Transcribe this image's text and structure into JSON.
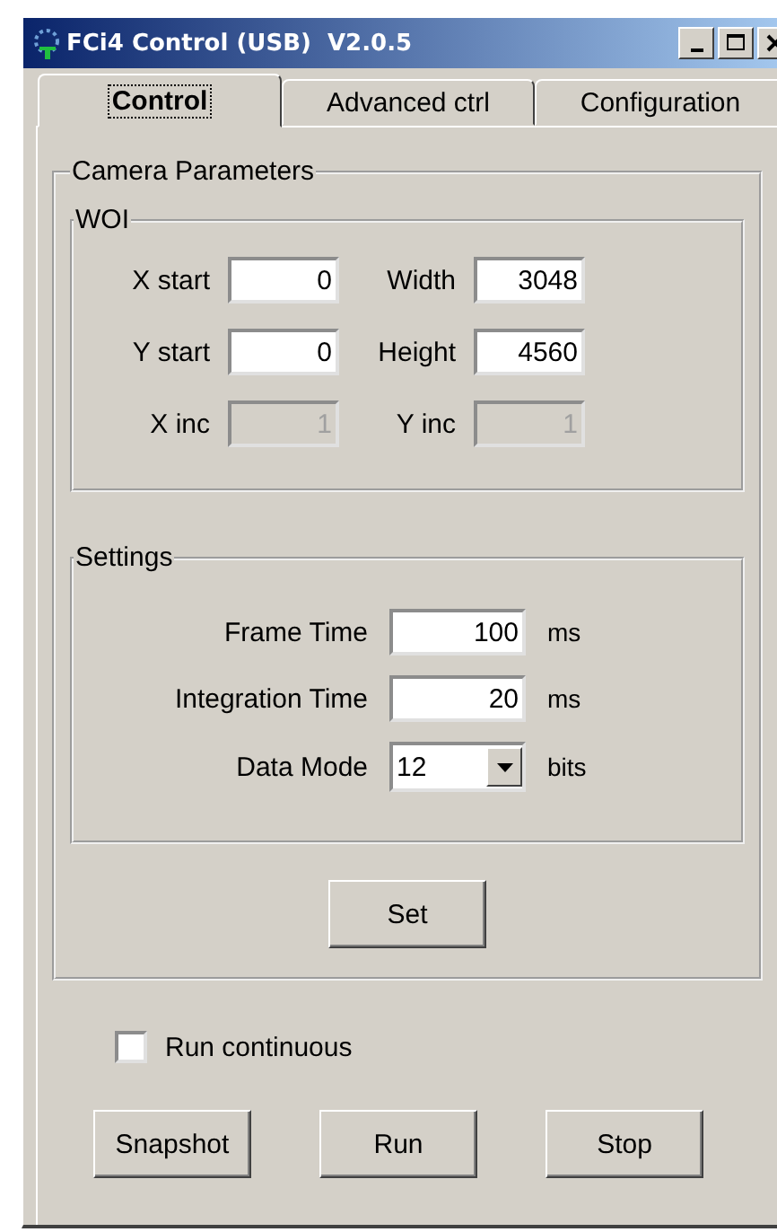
{
  "window": {
    "title": "FCi4 Control (USB)  V2.0.5"
  },
  "tabs": [
    {
      "label": "Control",
      "selected": true
    },
    {
      "label": "Advanced ctrl",
      "selected": false
    },
    {
      "label": "Configuration",
      "selected": false
    }
  ],
  "camera_parameters": {
    "title": "Camera Parameters",
    "woi": {
      "title": "WOI",
      "fields": [
        {
          "label": "X start",
          "value": "0",
          "disabled": false
        },
        {
          "label": "Width",
          "value": "3048",
          "disabled": false
        },
        {
          "label": "Y start",
          "value": "0",
          "disabled": false
        },
        {
          "label": "Height",
          "value": "4560",
          "disabled": false
        },
        {
          "label": "X inc",
          "value": "1",
          "disabled": true
        },
        {
          "label": "Y inc",
          "value": "1",
          "disabled": true
        }
      ]
    },
    "settings": {
      "title": "Settings",
      "rows": [
        {
          "kind": "text",
          "label": "Frame Time",
          "value": "100",
          "unit": "ms"
        },
        {
          "kind": "text",
          "label": "Integration Time",
          "value": "20",
          "unit": "ms"
        },
        {
          "kind": "dropdown",
          "label": "Data Mode",
          "value": "12",
          "unit": "bits"
        }
      ]
    },
    "set_button": "Set"
  },
  "run_continuous": {
    "label": "Run continuous",
    "checked": false
  },
  "buttons": [
    "Snapshot",
    "Run",
    "Stop"
  ]
}
